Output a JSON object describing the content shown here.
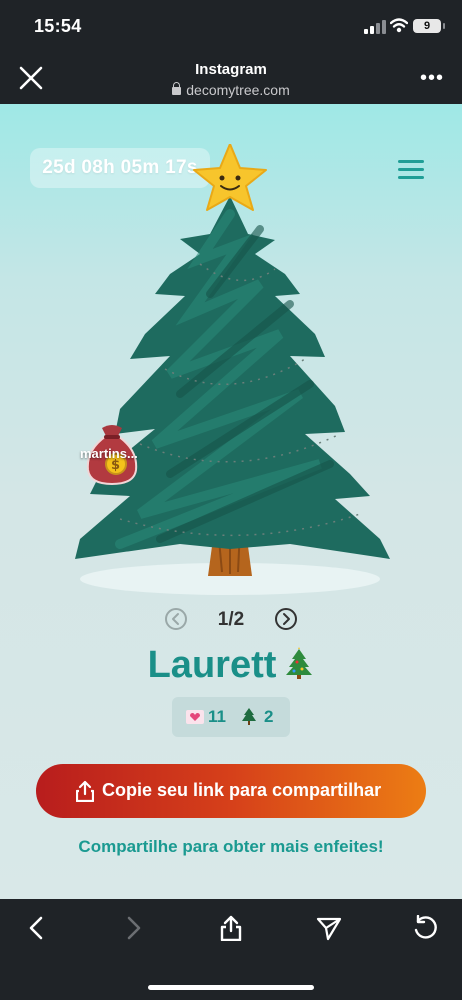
{
  "status_bar": {
    "time": "15:54",
    "battery": "9"
  },
  "browser": {
    "title": "Instagram",
    "url": "decomytree.com"
  },
  "countdown": "25d 08h 05m 17s",
  "ornament": {
    "label": "martins..."
  },
  "pager": {
    "text": "1/2"
  },
  "tree_owner": "Laurett",
  "stats": {
    "likes": "11",
    "trees": "2"
  },
  "share_button": {
    "label": "Copie seu link para compartilhar"
  },
  "hint": "Compartilhe para obter mais enfeites!",
  "colors": {
    "accent": "#1a8f88",
    "button_start": "#b81d1d",
    "button_end": "#ec7d14",
    "tree": "#1e6b5f"
  }
}
